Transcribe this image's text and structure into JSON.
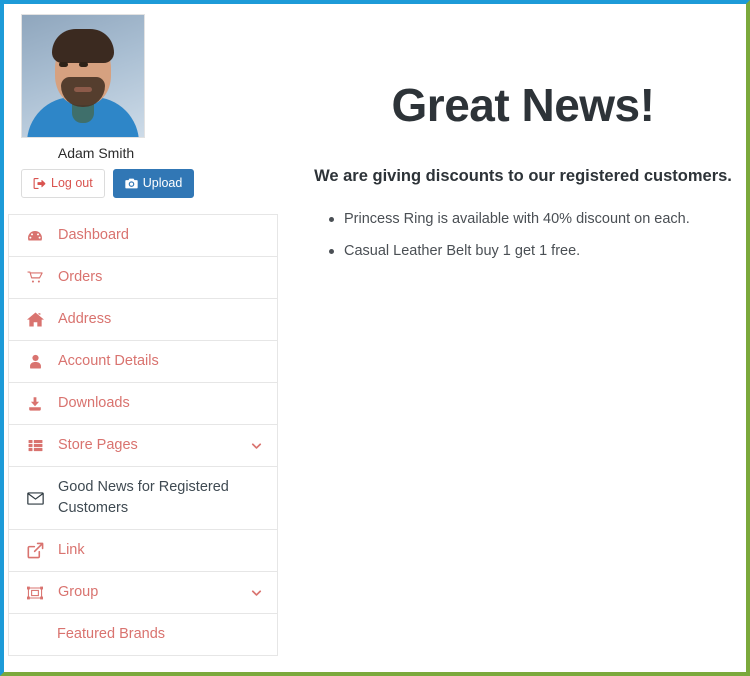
{
  "frame": {
    "border_top_color": "#1d9bd8",
    "border_left_color": "#1d9bd8",
    "border_right_color": "#7ba93c",
    "border_bottom_color": "#7ba93c"
  },
  "theme": {
    "link_color": "#d9736f",
    "active_color": "#2f3a41",
    "upload_button_bg": "#3177b5",
    "logout_text_color": "#d9534f",
    "heading_color": "#2d3338"
  },
  "sidebar": {
    "profile": {
      "name": "Adam Smith",
      "avatar_alt": "Adam Smith profile photo"
    },
    "buttons": {
      "logout": {
        "label": "Log out",
        "icon": "sign-out-icon"
      },
      "upload": {
        "label": "Upload",
        "icon": "camera-icon"
      }
    },
    "menu": [
      {
        "label": "Dashboard",
        "icon": "tachometer-icon",
        "active": false,
        "caret": false,
        "sub": false
      },
      {
        "label": "Orders",
        "icon": "shopping-cart-icon",
        "active": false,
        "caret": false,
        "sub": false
      },
      {
        "label": "Address",
        "icon": "home-icon",
        "active": false,
        "caret": false,
        "sub": false
      },
      {
        "label": "Account Details",
        "icon": "user-icon",
        "active": false,
        "caret": false,
        "sub": false
      },
      {
        "label": "Downloads",
        "icon": "download-icon",
        "active": false,
        "caret": false,
        "sub": false
      },
      {
        "label": "Store Pages",
        "icon": "th-list-icon",
        "active": false,
        "caret": true,
        "sub": false
      },
      {
        "label": "Good News for Registered Customers",
        "icon": "envelope-icon",
        "active": true,
        "caret": false,
        "sub": false
      },
      {
        "label": "Link",
        "icon": "external-link-icon",
        "active": false,
        "caret": false,
        "sub": false
      },
      {
        "label": "Group",
        "icon": "object-group-icon",
        "active": false,
        "caret": true,
        "sub": false
      },
      {
        "label": "Featured Brands",
        "icon": "",
        "active": false,
        "caret": false,
        "sub": true
      }
    ]
  },
  "main": {
    "title": "Great News!",
    "subtitle": "We are giving discounts to our registered customers.",
    "offers": [
      "Princess Ring is available with 40% discount on each.",
      "Casual Leather Belt buy 1 get 1 free."
    ]
  }
}
